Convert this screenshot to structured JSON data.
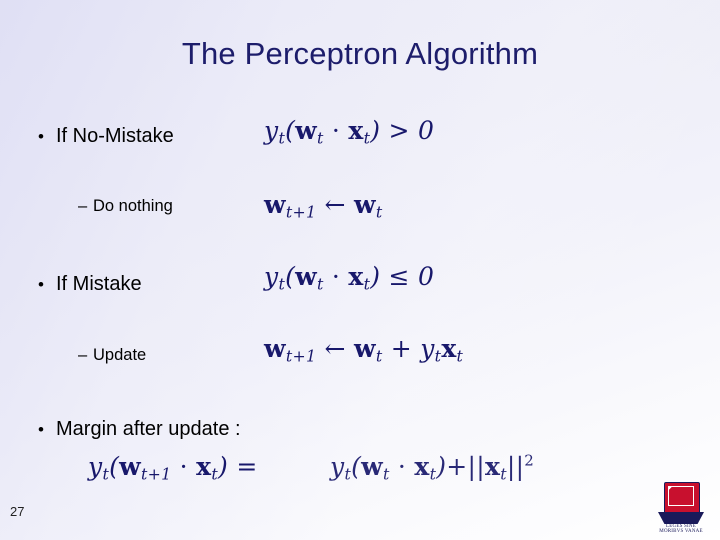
{
  "slide": {
    "title": "The Perceptron Algorithm",
    "page_number": "27",
    "bullets": [
      {
        "marker": "•",
        "text": "If No-Mistake"
      },
      {
        "marker": "–",
        "text": "Do nothing"
      },
      {
        "marker": "•",
        "text": "If Mistake"
      },
      {
        "marker": "–",
        "text": "Update"
      },
      {
        "marker": "•",
        "text": "Margin after update :"
      }
    ],
    "equations": [
      {
        "id": "no-mistake-condition",
        "text": "y_t ( w_t · x_t ) > 0"
      },
      {
        "id": "no-mistake-update",
        "text": "w_{t+1} ← w_t"
      },
      {
        "id": "mistake-condition",
        "text": "y_t ( w_t · x_t ) ≤ 0"
      },
      {
        "id": "mistake-update",
        "text": "w_{t+1} ← w_t + y_t x_t"
      },
      {
        "id": "margin-left",
        "text": "y_t ( w_{t+1} · x_t ) ="
      },
      {
        "id": "margin-right",
        "text": "y_t ( w_t · x_t ) + ||x_t||^2"
      }
    ],
    "logo": {
      "name": "university-shield-logo",
      "motto": "LEGES SINE MORIBVS VANAE"
    },
    "colors": {
      "title": "#1d1d6b",
      "math": "#18186b",
      "body_text": "#000000",
      "background_start": "#e9e9f7",
      "background_end": "#ffffff"
    }
  }
}
